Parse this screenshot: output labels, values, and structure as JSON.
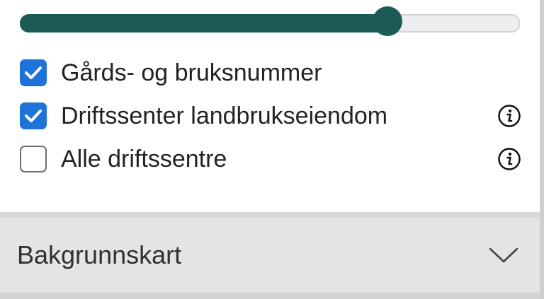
{
  "slider": {
    "value_fraction": 0.735,
    "accent_color": "#1b5b54"
  },
  "layers": [
    {
      "label": "Gårds- og bruksnummer",
      "checked": true,
      "has_info": false
    },
    {
      "label": "Driftssenter landbrukseiendom",
      "checked": true,
      "has_info": true
    },
    {
      "label": "Alle driftssentre",
      "checked": false,
      "has_info": true
    }
  ],
  "accordion": {
    "title": "Bakgrunnskart",
    "icon": "chevron-down-icon",
    "expanded": false
  },
  "colors": {
    "checkbox_checked": "#1e73d8",
    "panel_background": "#ffffff",
    "accordion_background": "#e4e4e4"
  }
}
